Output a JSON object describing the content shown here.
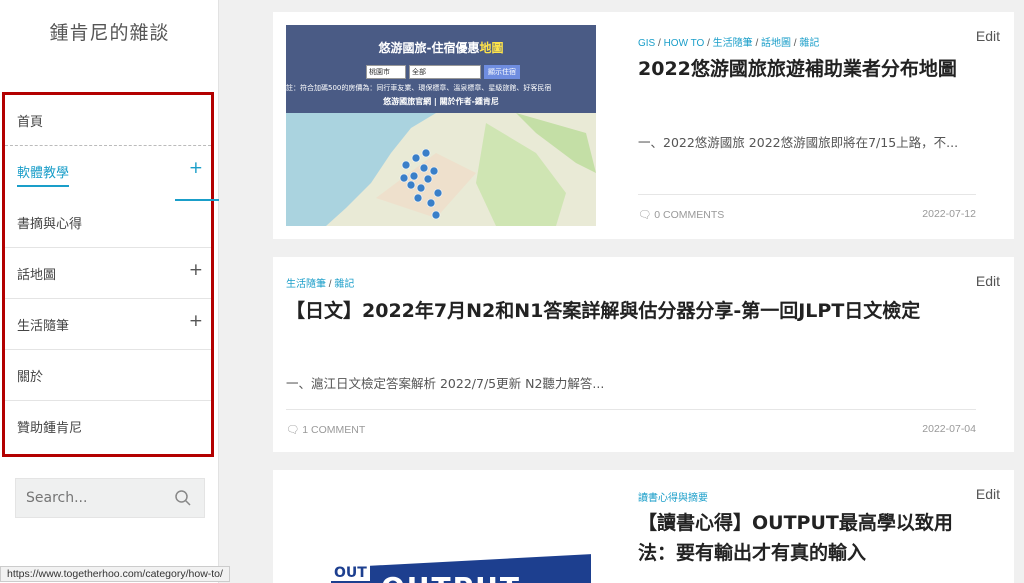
{
  "site": {
    "title": "鍾肯尼的雜談"
  },
  "menu": {
    "items": [
      {
        "label": "首頁",
        "has_sub": false
      },
      {
        "label": "軟體教學",
        "has_sub": true,
        "active": true
      },
      {
        "label": "書摘與心得",
        "has_sub": false
      },
      {
        "label": "話地圖",
        "has_sub": true
      },
      {
        "label": "生活隨筆",
        "has_sub": true
      },
      {
        "label": "關於",
        "has_sub": false
      },
      {
        "label": "贊助鍾肯尼",
        "has_sub": false
      }
    ],
    "expand_symbol": "+"
  },
  "search": {
    "placeholder": "Search..."
  },
  "status_bar": {
    "url": "https://www.togetherhoo.com/category/how-to/"
  },
  "colors": {
    "accent": "#1a9ec9",
    "highlight": "#b30000"
  },
  "posts": [
    {
      "categories": [
        "GIS",
        "HOW TO",
        "生活隨筆",
        "話地圖",
        "雜記"
      ],
      "title": "2022悠游國旅旅遊補助業者分布地圖",
      "excerpt": "一、2022悠游國旅 2022悠游國旅即將在7/15上路，不...",
      "comments": "0 COMMENTS",
      "date": "2022-07-12",
      "edit": "Edit",
      "thumbnail": {
        "title_prefix": "悠游國旅-住宿優惠",
        "title_highlight": "地圖",
        "select1": "桃園市",
        "select2": "全部",
        "button": "顯示住宿",
        "note": "註：符合加碼500的房價為：同行車友業、環保標章、溫泉標章、星級旅館、好客民宿",
        "footer": "悠游國旅官網 | 關於作者-鍾肯尼"
      }
    },
    {
      "categories": [
        "生活隨筆",
        "雜記"
      ],
      "title": "【日文】2022年7月N2和N1答案詳解與估分器分享-第一回JLPT日文檢定",
      "excerpt": "一、滬江日文檢定答案解析 2022/7/5更新 N2聽力解答...",
      "comments": "1 COMMENT",
      "date": "2022-07-04",
      "edit": "Edit"
    },
    {
      "categories": [
        "讀書心得與摘要"
      ],
      "title": "【讀書心得】OUTPUT最高學以致用法：要有輸出才有真的輸入",
      "edit": "Edit",
      "thumbnail": {
        "text": "OUTPUT",
        "side": "OUT"
      }
    }
  ]
}
